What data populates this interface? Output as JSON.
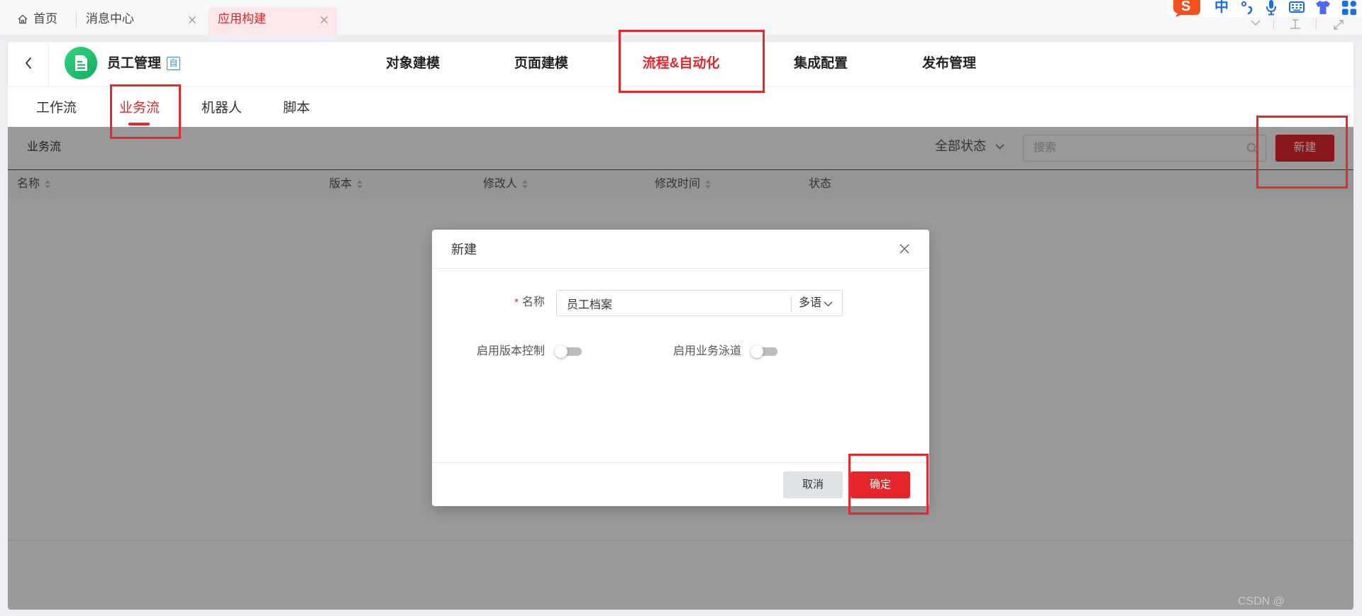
{
  "tabs": [
    {
      "label": "首页",
      "icon": "home-icon",
      "closable": false,
      "active": false
    },
    {
      "label": "消息中心",
      "closable": true,
      "active": false
    },
    {
      "label": "应用构建",
      "closable": true,
      "active": true
    }
  ],
  "ime_toolbar": {
    "logo_text": "S",
    "mode_label": "中",
    "icons": [
      "punctuation-icon",
      "microphone-icon",
      "keyboard-icon",
      "skin-icon",
      "toolbox-grid-icon"
    ]
  },
  "window_controls": [
    "chevron-down-icon",
    "pin-icon",
    "expand-icon"
  ],
  "app": {
    "name": "员工管理",
    "badge": "自",
    "logo_icon": "document-icon",
    "back_icon": "chevron-left-icon"
  },
  "nav": {
    "items": [
      "对象建模",
      "页面建模",
      "流程&自动化",
      "集成配置",
      "发布管理"
    ],
    "active_index": 2
  },
  "subtabs": {
    "items": [
      "工作流",
      "业务流",
      "机器人",
      "脚本"
    ],
    "active_index": 1
  },
  "toolbar": {
    "title": "业务流",
    "status_filter": "全部状态",
    "search_placeholder": "搜索",
    "new_button": "新建"
  },
  "table": {
    "columns": [
      {
        "label": "名称",
        "sortable": true
      },
      {
        "label": "版本",
        "sortable": true
      },
      {
        "label": "修改人",
        "sortable": true
      },
      {
        "label": "修改时间",
        "sortable": true
      },
      {
        "label": "状态",
        "sortable": false
      }
    ],
    "rows": []
  },
  "modal": {
    "title": "新建",
    "name_field": {
      "required_mark": "*",
      "label": "名称",
      "value": "员工档案",
      "lang_button": "多语"
    },
    "version_control": {
      "label": "启用版本控制",
      "enabled": false
    },
    "business_swimlane": {
      "label": "启用业务泳道",
      "enabled": false
    },
    "cancel_button": "取消",
    "confirm_button": "确定"
  },
  "colors": {
    "accent": "#e5262b",
    "annotation": "#e8262b",
    "logo_green": "#1cbf6c",
    "badge_blue": "#3a86f0",
    "ime_blue": "#1a6fe0",
    "ime_logo": "#f4511e"
  },
  "watermark": "CSDN @"
}
